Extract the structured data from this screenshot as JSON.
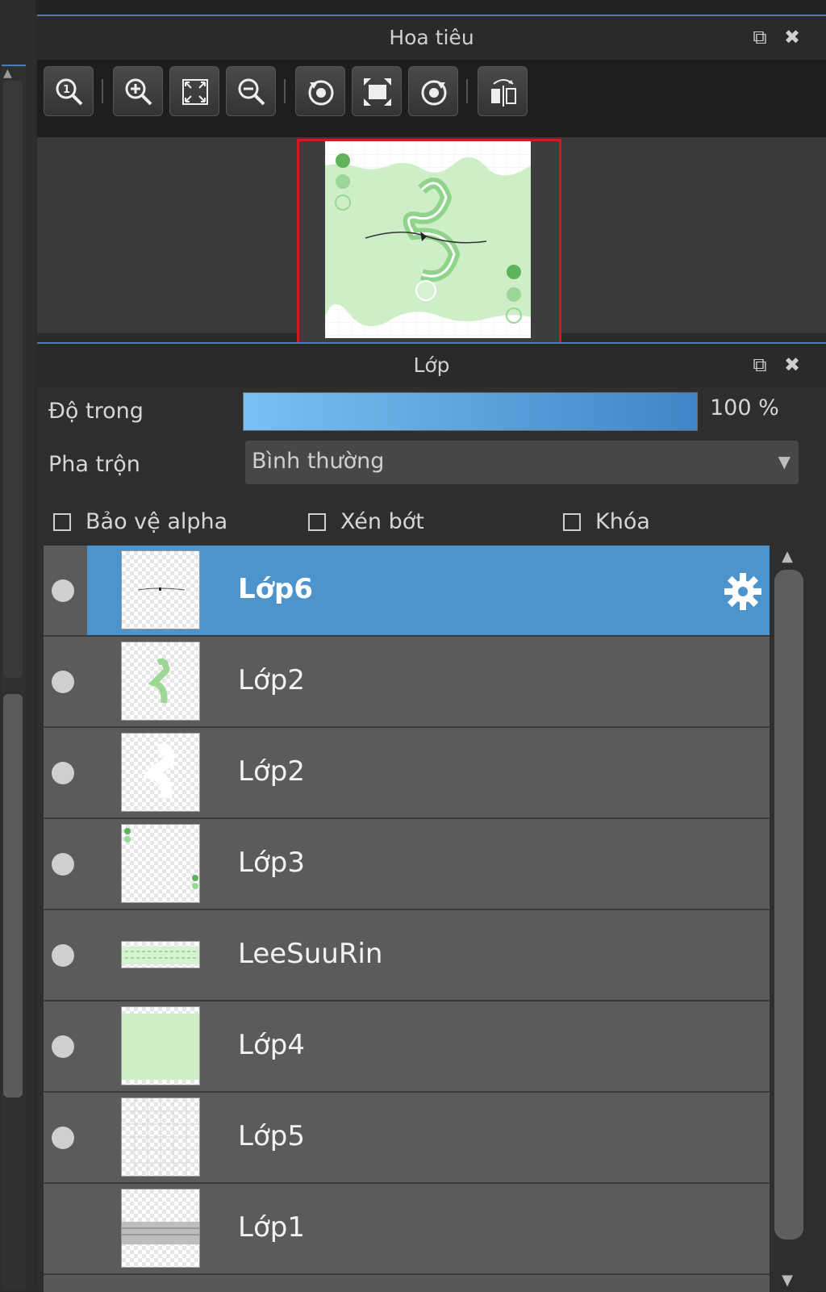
{
  "navigator": {
    "title": "Hoa tiêu",
    "toolbar": [
      {
        "icon": "zoom-actual-size-icon"
      },
      {
        "icon": "zoom-in-icon"
      },
      {
        "icon": "fit-to-window-icon"
      },
      {
        "icon": "zoom-out-icon"
      },
      {
        "icon": "rotate-left-icon"
      },
      {
        "icon": "reset-view-icon"
      },
      {
        "icon": "rotate-right-icon"
      },
      {
        "icon": "flip-horizontal-icon"
      }
    ]
  },
  "layers_panel": {
    "title": "Lớp",
    "opacity_label": "Độ trong",
    "opacity_value": "100 %",
    "opacity_fraction": 1.0,
    "blend_label": "Pha trộn",
    "blend_value": "Bình thường",
    "checkboxes": {
      "protect_alpha": "Bảo vệ alpha",
      "clipping": "Xén bớt",
      "lock": "Khóa"
    },
    "layers": [
      {
        "name": "Lớp6",
        "selected": true
      },
      {
        "name": "Lớp2",
        "selected": false
      },
      {
        "name": "Lớp2",
        "selected": false
      },
      {
        "name": "Lớp3",
        "selected": false
      },
      {
        "name": "LeeSuuRin",
        "selected": false
      },
      {
        "name": "Lớp4",
        "selected": false
      },
      {
        "name": "Lớp5",
        "selected": false
      },
      {
        "name": "Lớp1",
        "selected": false
      }
    ]
  },
  "colors": {
    "accent": "#4d93cc",
    "navigator_frame": "#d01c1c",
    "canvas_green": "#cdeec7"
  }
}
